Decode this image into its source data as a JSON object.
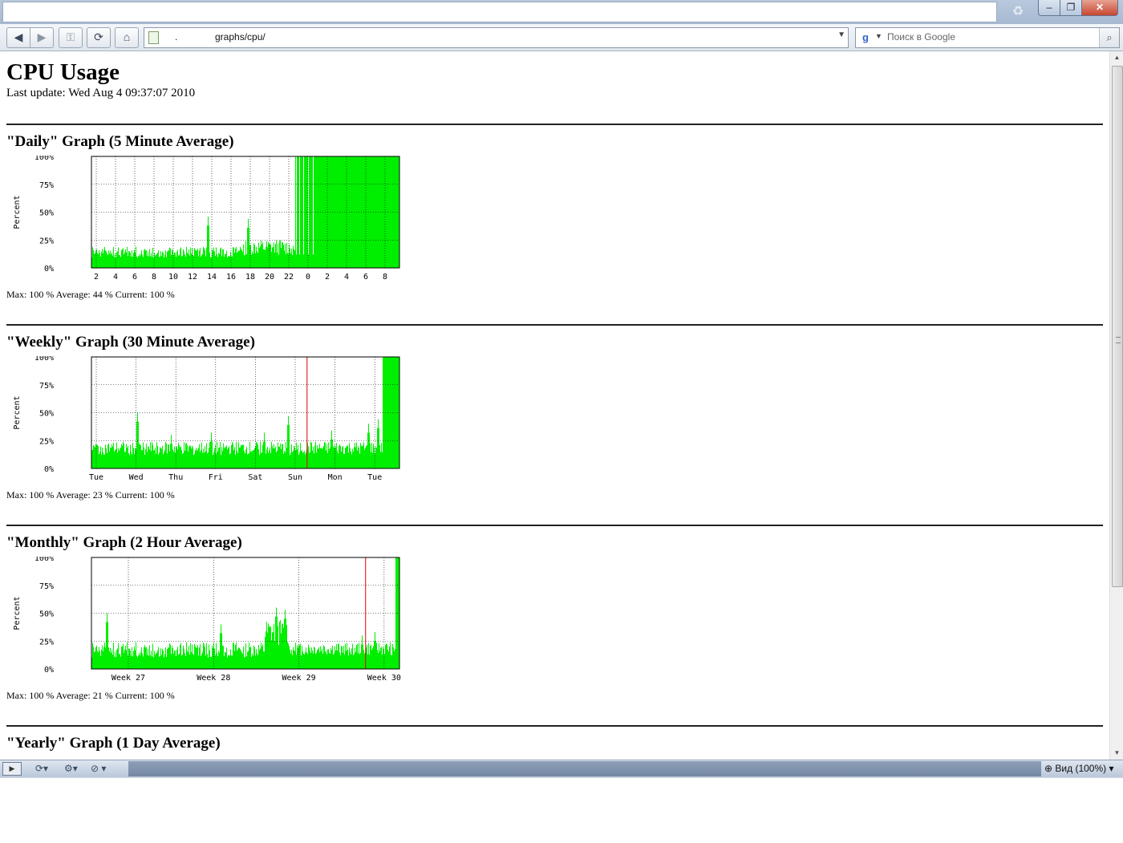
{
  "browser": {
    "url": ".              graphs/cpu/",
    "search_placeholder": "Поиск в Google",
    "zoom_label": "Вид (100%)"
  },
  "page": {
    "title": "CPU Usage",
    "last_update": "Last update: Wed Aug 4 09:37:07 2010"
  },
  "graphs": [
    {
      "title": "\"Daily\" Graph (5 Minute Average)",
      "stats": "Max: 100 %  Average: 44 %  Current: 100 %",
      "ylabel": "Percent",
      "y_ticks": [
        "100%",
        "75%",
        "50%",
        "25%",
        "0%"
      ],
      "x_ticks": [
        "2",
        "4",
        "6",
        "8",
        "10",
        "12",
        "14",
        "16",
        "18",
        "20",
        "22",
        "0",
        "2",
        "4",
        "6",
        "8"
      ],
      "chart_data": {
        "type": "area",
        "ylim": [
          0,
          100
        ],
        "segments": [
          {
            "from": 0,
            "to": 0.48,
            "level": 14,
            "noise": 5
          },
          {
            "from": 0.48,
            "to": 0.66,
            "level": 18,
            "noise": 7
          },
          {
            "from": 0.66,
            "to": 1.0,
            "level": 100,
            "noise": 0
          }
        ],
        "spikes": [
          [
            0.38,
            46
          ],
          [
            0.51,
            44
          ]
        ],
        "gaps": [
          0.665,
          0.675,
          0.69,
          0.705,
          0.72
        ]
      }
    },
    {
      "title": "\"Weekly\" Graph (30 Minute Average)",
      "stats": "Max: 100 %  Average: 23 %  Current: 100 %",
      "ylabel": "Percent",
      "y_ticks": [
        "100%",
        "75%",
        "50%",
        "25%",
        "0%"
      ],
      "x_ticks": [
        "Tue",
        "Wed",
        "Thu",
        "Fri",
        "Sat",
        "Sun",
        "Mon",
        "Tue"
      ],
      "chart_data": {
        "type": "area",
        "ylim": [
          0,
          100
        ],
        "segments": [
          {
            "from": 0,
            "to": 0.945,
            "level": 18,
            "noise": 6
          },
          {
            "from": 0.945,
            "to": 1.0,
            "level": 100,
            "noise": 0
          }
        ],
        "spikes": [
          [
            0.15,
            50
          ],
          [
            0.26,
            30
          ],
          [
            0.39,
            32
          ],
          [
            0.56,
            32
          ],
          [
            0.64,
            47
          ],
          [
            0.78,
            34
          ],
          [
            0.9,
            40
          ],
          [
            0.93,
            44
          ]
        ],
        "redline": 0.7
      }
    },
    {
      "title": "\"Monthly\" Graph (2 Hour Average)",
      "stats": "Max: 100 %  Average: 21 %  Current: 100 %",
      "ylabel": "Percent",
      "y_ticks": [
        "100%",
        "75%",
        "50%",
        "25%",
        "0%"
      ],
      "x_ticks": [
        "Week 27",
        "Week 28",
        "Week 29",
        "Week 30"
      ],
      "chart_data": {
        "type": "area",
        "ylim": [
          0,
          100
        ],
        "segments": [
          {
            "from": 0,
            "to": 0.56,
            "level": 17,
            "noise": 7
          },
          {
            "from": 0.56,
            "to": 0.64,
            "level": 32,
            "noise": 12
          },
          {
            "from": 0.64,
            "to": 0.985,
            "level": 18,
            "noise": 6
          },
          {
            "from": 0.985,
            "to": 1.0,
            "level": 100,
            "noise": 0
          }
        ],
        "spikes": [
          [
            0.05,
            50
          ],
          [
            0.42,
            40
          ],
          [
            0.6,
            55
          ],
          [
            0.63,
            53
          ],
          [
            0.88,
            30
          ],
          [
            0.92,
            33
          ]
        ],
        "redline": 0.89
      }
    },
    {
      "title": "\"Yearly\" Graph (1 Day Average)"
    }
  ]
}
